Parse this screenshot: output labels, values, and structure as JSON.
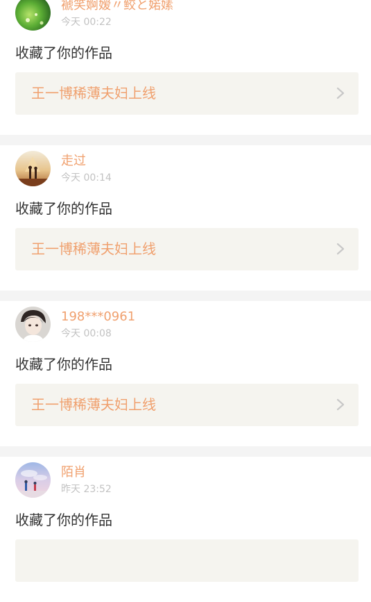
{
  "feed": {
    "items": [
      {
        "username": "褫笑婀嫒〃鲛と婼嫊",
        "time": "今天 00:22",
        "action": "收藏了你的作品",
        "work_title": "王一博稀薄夫妇上线",
        "avatar_icon": "avatar-green-nature-icon"
      },
      {
        "username": "走过",
        "time": "今天 00:14",
        "action": "收藏了你的作品",
        "work_title": "王一博稀薄夫妇上线",
        "avatar_icon": "avatar-couple-sunset-icon"
      },
      {
        "username": "198***0961",
        "time": "今天 00:08",
        "action": "收藏了你的作品",
        "work_title": "王一博稀薄夫妇上线",
        "avatar_icon": "avatar-anime-boy-icon"
      },
      {
        "username": "陌肖",
        "time": "昨天 23:52",
        "action": "收藏了你的作品",
        "work_title": "",
        "avatar_icon": "avatar-sky-couple-icon"
      }
    ]
  },
  "colors": {
    "accent": "#f0a06e",
    "time_text": "#c2c2c2",
    "body_text": "#333333",
    "work_box_bg": "#f5f4ef",
    "separator": "#f4f4f4",
    "chevron": "#c8c8c8"
  }
}
